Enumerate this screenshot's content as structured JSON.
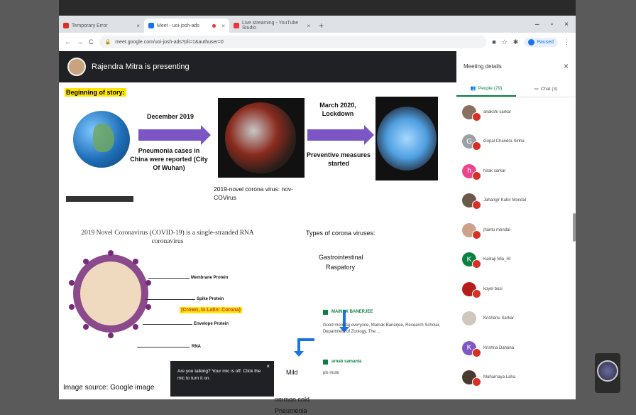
{
  "browser": {
    "tabs": [
      {
        "label": "Temporary Error",
        "fav_color": "#d93025",
        "close": "×"
      },
      {
        "label": "Meet - uoi-josh-ads",
        "fav_color": "#1a73e8",
        "close": "×"
      },
      {
        "label": "Live streaming - YouTube Studio",
        "fav_color": "#e33",
        "close": "×"
      }
    ],
    "new_tab": "+",
    "win_controls": [
      "–",
      "▫",
      "×"
    ],
    "url": "meet.google.com/uoi-josh-ads?pli=1&authuser=0",
    "paused_label": "Paused"
  },
  "presenter": {
    "text": "Rajendra Mitra is presenting"
  },
  "slide": {
    "highlight_title": "Beginning of story:",
    "arrow1_top": "December 2019",
    "arrow1_bottom": "Pneumonia cases in China were reported (City Of Wuhan)",
    "virus_caption": "2019-novel corona virus: nov-COVirus",
    "arrow2_top": "March 2020, Lockdown",
    "arrow2_bottom": "Preventive measures started",
    "covid_title": "2019 Novel Coronavirus (COVID-19) is a single-stranded RNA coronavirus",
    "label_membrane": "Membrane Protein",
    "label_spike": "Spike Protein",
    "label_crown": "(Crown, in Latin: Corona)",
    "label_envelope": "Envelope Protein",
    "label_rna": "RNA",
    "image_source": "Image source: Google image",
    "types_title": "Types of corona viruses:",
    "gastro": "Gastrointestinal",
    "raspatory": "Raspatory",
    "mild": "Mild",
    "common_cold": "ommon cold",
    "pneumonia": "Pneumonia"
  },
  "chat_overlay": {
    "msg1_name": "MAINAK BANERJEE",
    "msg1_text": "Good morning everyone, Mainak Banerjee, Research Scholar, Department of Zoology, The ...",
    "msg2_name": "arnab samanta",
    "msg2_text": "pls mute"
  },
  "toast": {
    "text": "Are you talking? Your mic is off. Click the mic to turn it on.",
    "close": "×"
  },
  "panel": {
    "title": "Meeting details",
    "close": "×",
    "tab_people": "People (79)",
    "tab_chat": "Chat (3)",
    "participants": [
      {
        "name": "anakshi sarkar",
        "initial": "",
        "color": "#8a7060"
      },
      {
        "name": "Gopal Chandra Sinha",
        "initial": "G",
        "color": "#9aa0a6"
      },
      {
        "name": "hirak sarkar",
        "initial": "h",
        "color": "#e8478b"
      },
      {
        "name": "Jahangir Kabir Mondal",
        "initial": "",
        "color": "#6b5a4a"
      },
      {
        "name": "jhantu mondal",
        "initial": "",
        "color": "#caa38a"
      },
      {
        "name": "Kalkaji Mia_HI",
        "initial": "K",
        "color": "#0b8043"
      },
      {
        "name": "koyel bosi",
        "initial": "",
        "color": "#b71c1c"
      },
      {
        "name": "Krishanu Sarkar",
        "initial": "",
        "color": "#cfc7bd"
      },
      {
        "name": "Krishna Dahana",
        "initial": "K",
        "color": "#7e57c2"
      },
      {
        "name": "Maharnaya Laha",
        "initial": "",
        "color": "#4a3a30"
      }
    ]
  }
}
